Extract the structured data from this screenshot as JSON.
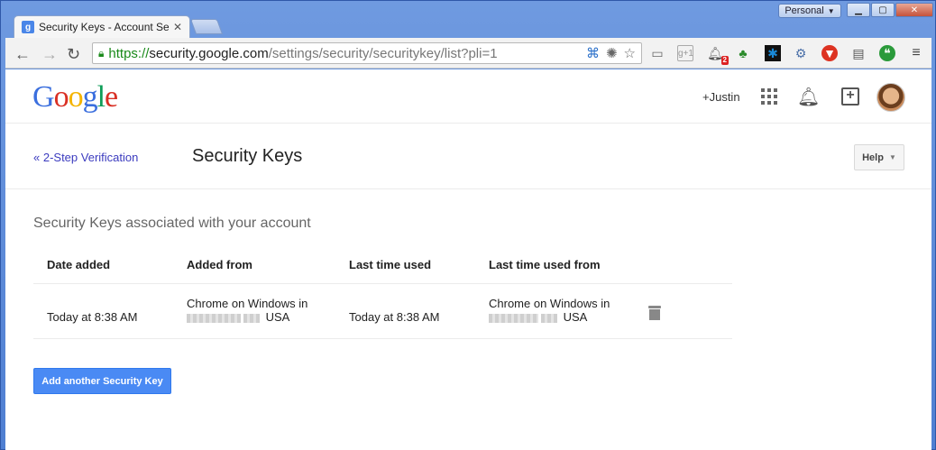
{
  "browser": {
    "profile_label": "Personal",
    "tab_title": "Security Keys - Account Setti",
    "tab_favicon_letter": "g",
    "url_scheme": "https://",
    "url_host": "security.google.com",
    "url_path": "/settings/security/securitykey/list?pli=1",
    "extension_badge": "2"
  },
  "google_bar": {
    "logo_letters": [
      "G",
      "o",
      "o",
      "g",
      "l",
      "e"
    ],
    "logo_colors": [
      "#3b6fde",
      "#d93025",
      "#f4b400",
      "#3b6fde",
      "#0f9d58",
      "#d93025"
    ],
    "user_link": "+Justin"
  },
  "header": {
    "back_link": "« 2-Step Verification",
    "title": "Security Keys",
    "help_label": "Help"
  },
  "main": {
    "section_heading": "Security Keys associated with your account",
    "table": {
      "columns": [
        "Date added",
        "Added from",
        "Last time used",
        "Last time used from"
      ],
      "rows": [
        {
          "date_added": "Today at 8:38 AM",
          "added_from_line1": "Chrome on Windows in",
          "added_from_line2": "USA",
          "last_used": "Today at 8:38 AM",
          "last_used_from_line1": "Chrome on Windows in",
          "last_used_from_line2": "USA"
        }
      ]
    },
    "add_button": "Add another Security Key"
  }
}
